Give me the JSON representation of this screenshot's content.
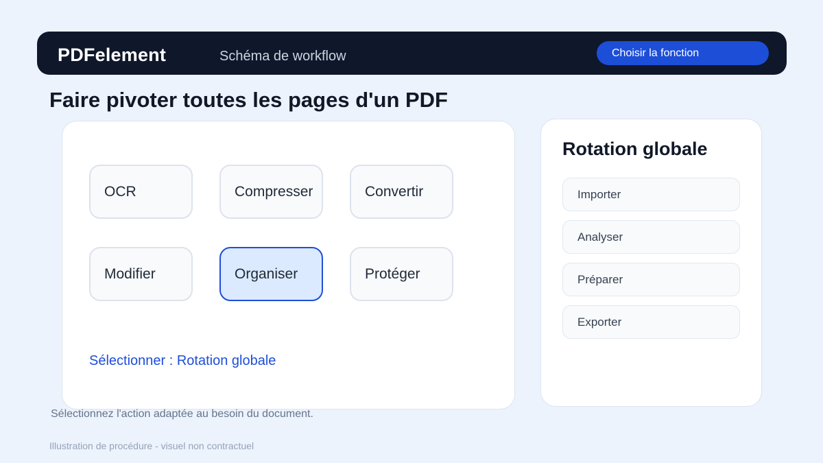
{
  "header": {
    "brand": "PDFelement",
    "subtitle": "Schéma de workflow",
    "cta_label": "Choisir la fonction"
  },
  "page_title": "Faire pivoter toutes les pages d'un PDF",
  "functions": {
    "items": [
      {
        "label": "OCR",
        "selected": false
      },
      {
        "label": "Compresser",
        "selected": false
      },
      {
        "label": "Convertir",
        "selected": false
      },
      {
        "label": "Modifier",
        "selected": false
      },
      {
        "label": "Organiser",
        "selected": true
      },
      {
        "label": "Protéger",
        "selected": false
      }
    ],
    "selection_text": "Sélectionner : Rotation globale"
  },
  "side_panel": {
    "title": "Rotation globale",
    "steps": [
      {
        "label": "Importer"
      },
      {
        "label": "Analyser"
      },
      {
        "label": "Préparer"
      },
      {
        "label": "Exporter"
      }
    ]
  },
  "hint": "Sélectionnez l'action adaptée au besoin du document.",
  "footnote": "Illustration de procédure - visuel non contractuel",
  "colors": {
    "background": "#ecf3fd",
    "header_bg": "#0f172a",
    "accent": "#1d4ed8",
    "selected_tile_bg": "#dbeafe"
  }
}
